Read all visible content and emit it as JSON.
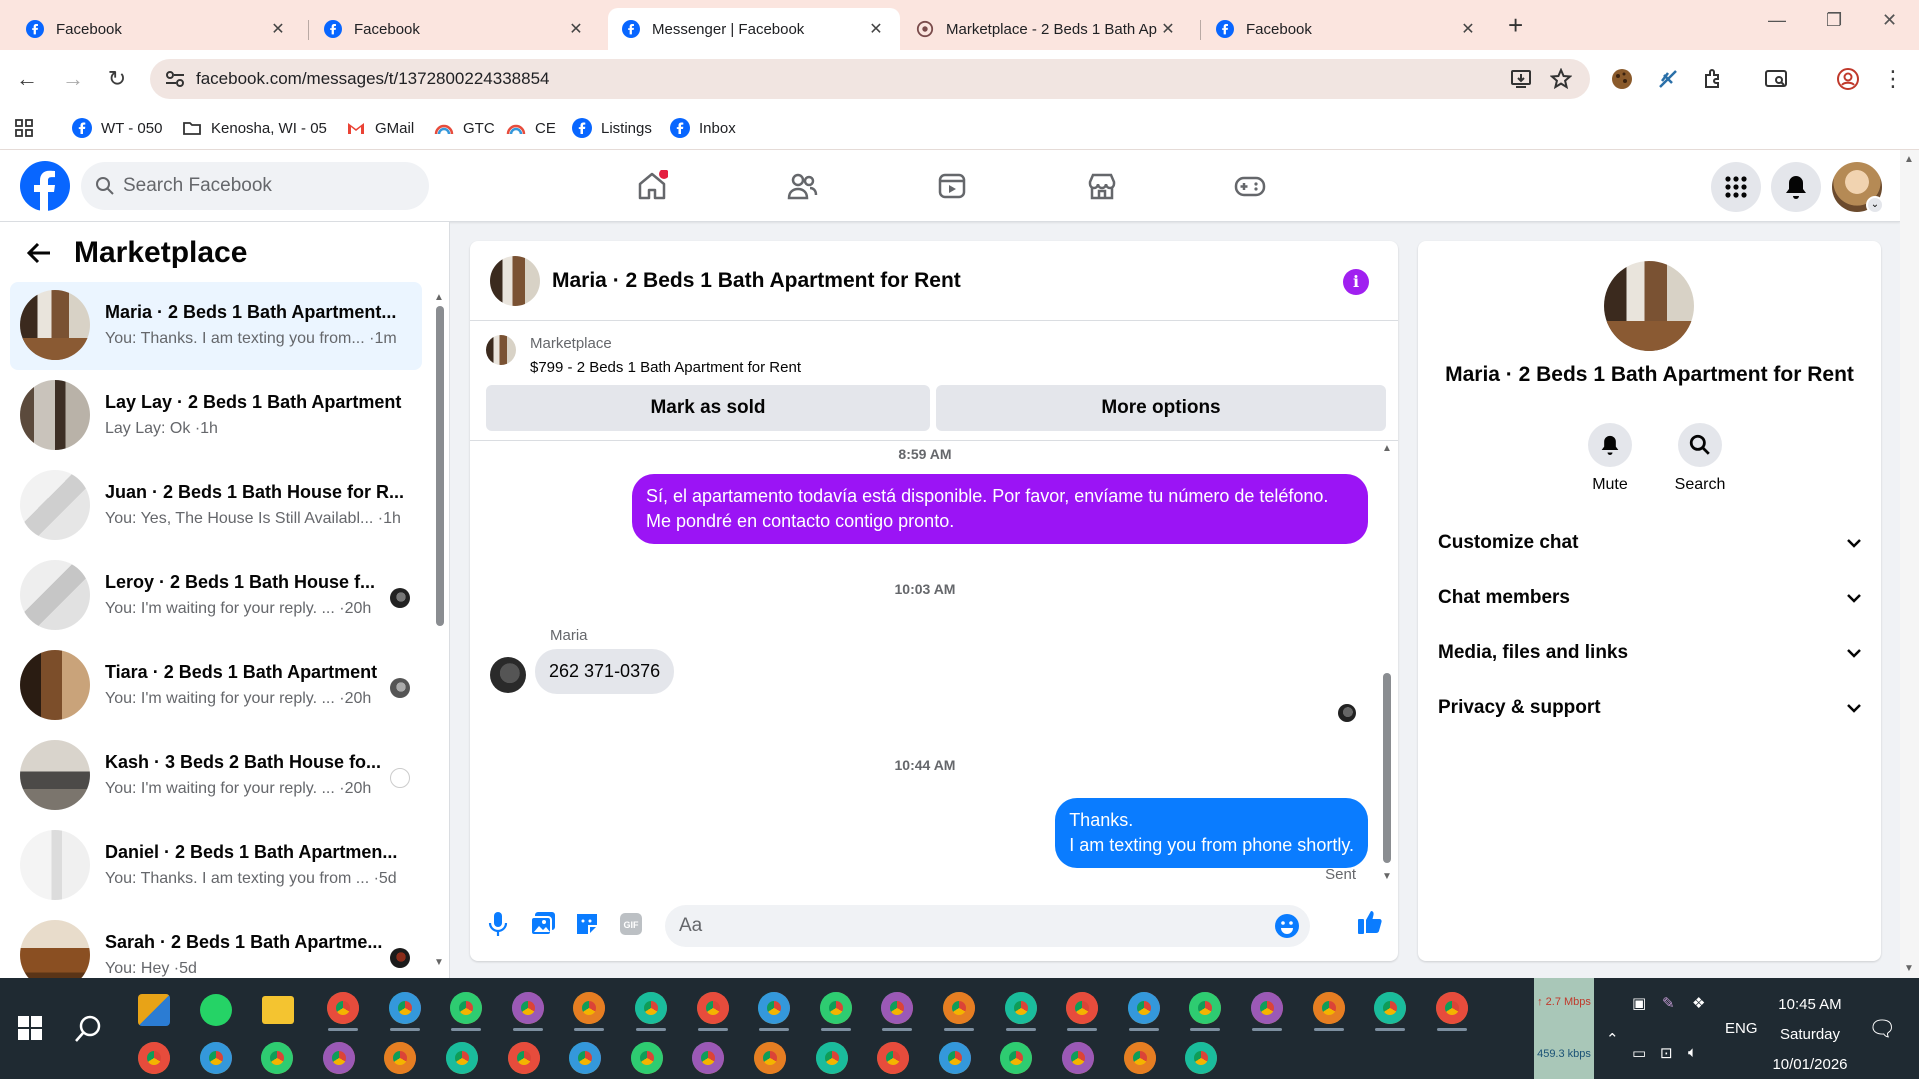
{
  "browser": {
    "tabs": [
      {
        "label": "Facebook",
        "active": false
      },
      {
        "label": "Facebook",
        "active": false
      },
      {
        "label": "Messenger | Facebook",
        "active": true
      },
      {
        "label": "Marketplace - 2 Beds 1 Bath Ap",
        "active": false
      },
      {
        "label": "Facebook",
        "active": false
      }
    ],
    "url": "facebook.com/messages/t/1372800224338854",
    "bookmarks": [
      "WT - 050",
      "Kenosha, WI - 05",
      "GMail",
      "GTC",
      "CE",
      "Listings",
      "Inbox"
    ]
  },
  "fbnav": {
    "search_placeholder": "Search Facebook",
    "colors": {
      "brand": "#0866ff",
      "notification": "#e41e3f"
    }
  },
  "sidebar": {
    "title": "Marketplace",
    "conversations": [
      {
        "name": "Maria · 2 Beds 1 Bath Apartment...",
        "snippet": "You: Thanks. I am texting you from... ·1m",
        "selected": true
      },
      {
        "name": "Lay Lay · 2 Beds 1 Bath Apartment",
        "snippet": "Lay Lay: Ok ·1h",
        "selected": false
      },
      {
        "name": "Juan · 2 Beds 1 Bath House for R...",
        "snippet": "You: Yes, The House Is Still Availabl... ·1h",
        "selected": false
      },
      {
        "name": "Leroy · 2 Beds 1 Bath House f...",
        "snippet": "You: I'm waiting for your reply. ... ·20h",
        "selected": false
      },
      {
        "name": "Tiara · 2 Beds 1 Bath Apartment",
        "snippet": "You: I'm waiting for your reply. ... ·20h",
        "selected": false
      },
      {
        "name": "Kash · 3 Beds 2 Bath House fo...",
        "snippet": "You: I'm waiting for your reply. ... ·20h",
        "selected": false
      },
      {
        "name": "Daniel · 2 Beds 1 Bath Apartmen...",
        "snippet": "You: Thanks. I am texting you from ... ·5d",
        "selected": false
      },
      {
        "name": "Sarah · 2 Beds 1 Bath Apartme...",
        "snippet": "You: Hey ·5d",
        "selected": false
      }
    ]
  },
  "chat": {
    "title": "Maria · 2 Beds 1 Bath Apartment for Rent",
    "listing": {
      "source": "Marketplace",
      "title": "$799 - 2 Beds 1 Bath Apartment for Rent",
      "mark_sold_label": "Mark as sold",
      "more_options_label": "More options"
    },
    "messages": {
      "stamp1": "8:59 AM",
      "out1_line1": "Sí, el apartamento todavía está disponible. Por favor, envíame tu número de teléfono.",
      "out1_line2": "Me pondré en contacto contigo pronto.",
      "stamp2": "10:03 AM",
      "sender": "Maria",
      "in1": "262 371-0376",
      "stamp3": "10:44 AM",
      "out2_line1": "Thanks.",
      "out2_line2": "I am texting you from phone shortly.",
      "status": "Sent"
    },
    "composer_placeholder": "Aa",
    "colors": {
      "bubble_purple": "#9b14f5",
      "bubble_blue": "#0a7cff",
      "accent": "#0a7cff"
    }
  },
  "info_panel": {
    "name": "Maria · 2 Beds 1 Bath Apartment for Rent",
    "actions": [
      {
        "label": "Mute",
        "icon": "bell-icon"
      },
      {
        "label": "Search",
        "icon": "search-icon"
      }
    ],
    "sections": [
      "Customize chat",
      "Chat members",
      "Media, files and links",
      "Privacy & support"
    ]
  },
  "taskbar": {
    "net_up": "↑ 2.7 Mbps",
    "net_down": "459.3 kbps",
    "lang": "ENG",
    "time": "10:45 AM",
    "day": "Saturday",
    "date": "10/01/2026"
  }
}
